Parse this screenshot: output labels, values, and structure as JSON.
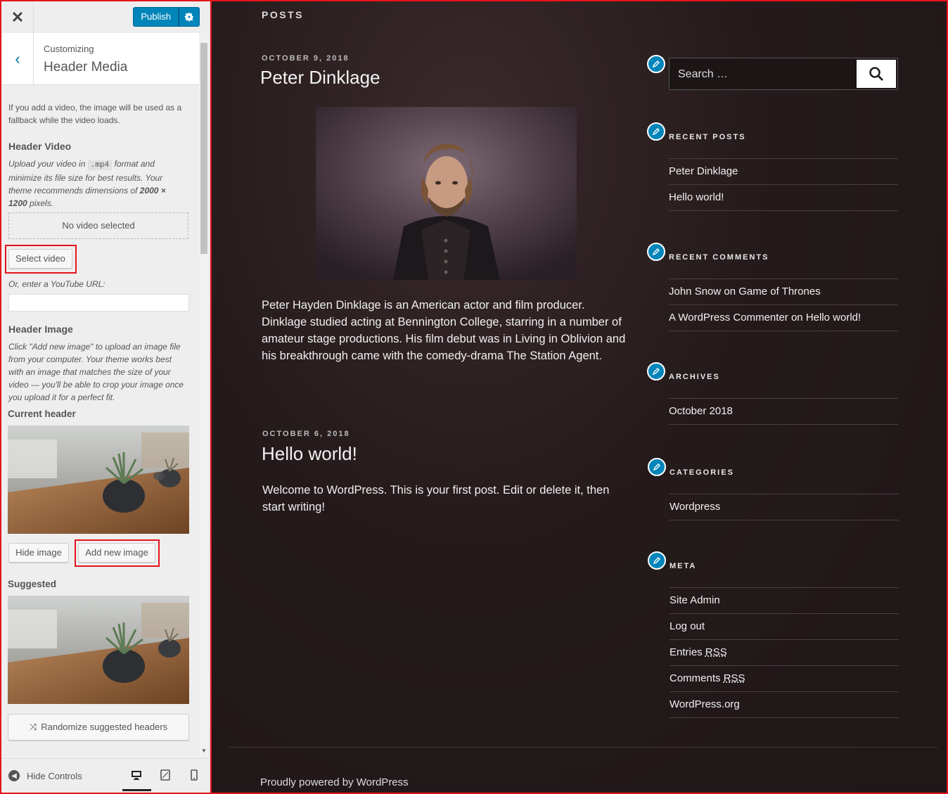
{
  "customizer": {
    "close_icon": "✕",
    "publish_label": "Publish",
    "customizing_label": "Customizing",
    "section_title": "Header Media",
    "intro_text": "If you add a video, the image will be used as a fallback while the video loads.",
    "header_video": {
      "heading": "Header Video",
      "desc_1": "Upload your video in",
      "desc_code": ".mp4",
      "desc_2": "format and minimize its file size for best results. Your theme recommends dimensions of",
      "desc_dims": "2000 × 1200",
      "desc_3": "pixels.",
      "no_video": "No video selected",
      "select_button": "Select video",
      "youtube_label": "Or, enter a YouTube URL:",
      "youtube_value": ""
    },
    "header_image": {
      "heading": "Header Image",
      "desc": "Click \"Add new image\" to upload an image file from your computer. Your theme works best with an image that matches the size of your video — you'll be able to crop your image once you upload it for a perfect fit.",
      "current_label": "Current header",
      "hide_button": "Hide image",
      "add_button": "Add new image",
      "suggested_label": "Suggested",
      "randomize_button": "Randomize suggested headers"
    },
    "footer": {
      "hide_controls": "Hide Controls"
    }
  },
  "preview": {
    "posts_label": "POSTS",
    "posts": [
      {
        "date": "OCTOBER 9, 2018",
        "title": "Peter Dinklage",
        "body": "Peter Hayden Dinklage is an American actor and film producer. Dinklage studied acting at Bennington College, starring in a number of amateur stage productions. His film debut was in Living in Oblivion and his breakthrough came with the comedy-drama The Station Agent."
      },
      {
        "date": "OCTOBER 6, 2018",
        "title": "Hello world!",
        "body": "Welcome to WordPress. This is your first post. Edit or delete it, then start writing!"
      }
    ],
    "search_placeholder": "Search …",
    "widgets": {
      "recent_posts": {
        "title": "RECENT POSTS",
        "items": [
          "Peter Dinklage",
          "Hello world!"
        ]
      },
      "recent_comments": {
        "title": "RECENT COMMENTS",
        "items": [
          {
            "author": "John Snow",
            "on": "on",
            "post": "Game of Thrones"
          },
          {
            "author": "A WordPress Commenter",
            "on": "on",
            "post": "Hello world!"
          }
        ]
      },
      "archives": {
        "title": "ARCHIVES",
        "items": [
          "October 2018"
        ]
      },
      "categories": {
        "title": "CATEGORIES",
        "items": [
          "Wordpress"
        ]
      },
      "meta": {
        "title": "META",
        "items": [
          "Site Admin",
          "Log out"
        ],
        "entries": "Entries",
        "comments": "Comments",
        "rss": "RSS",
        "wporg": "WordPress.org"
      }
    },
    "footer_credit": "Proudly powered by WordPress"
  },
  "colors": {
    "accent": "#0085ba",
    "highlight": "#e5141b",
    "preview_bg": "#231a1b"
  }
}
